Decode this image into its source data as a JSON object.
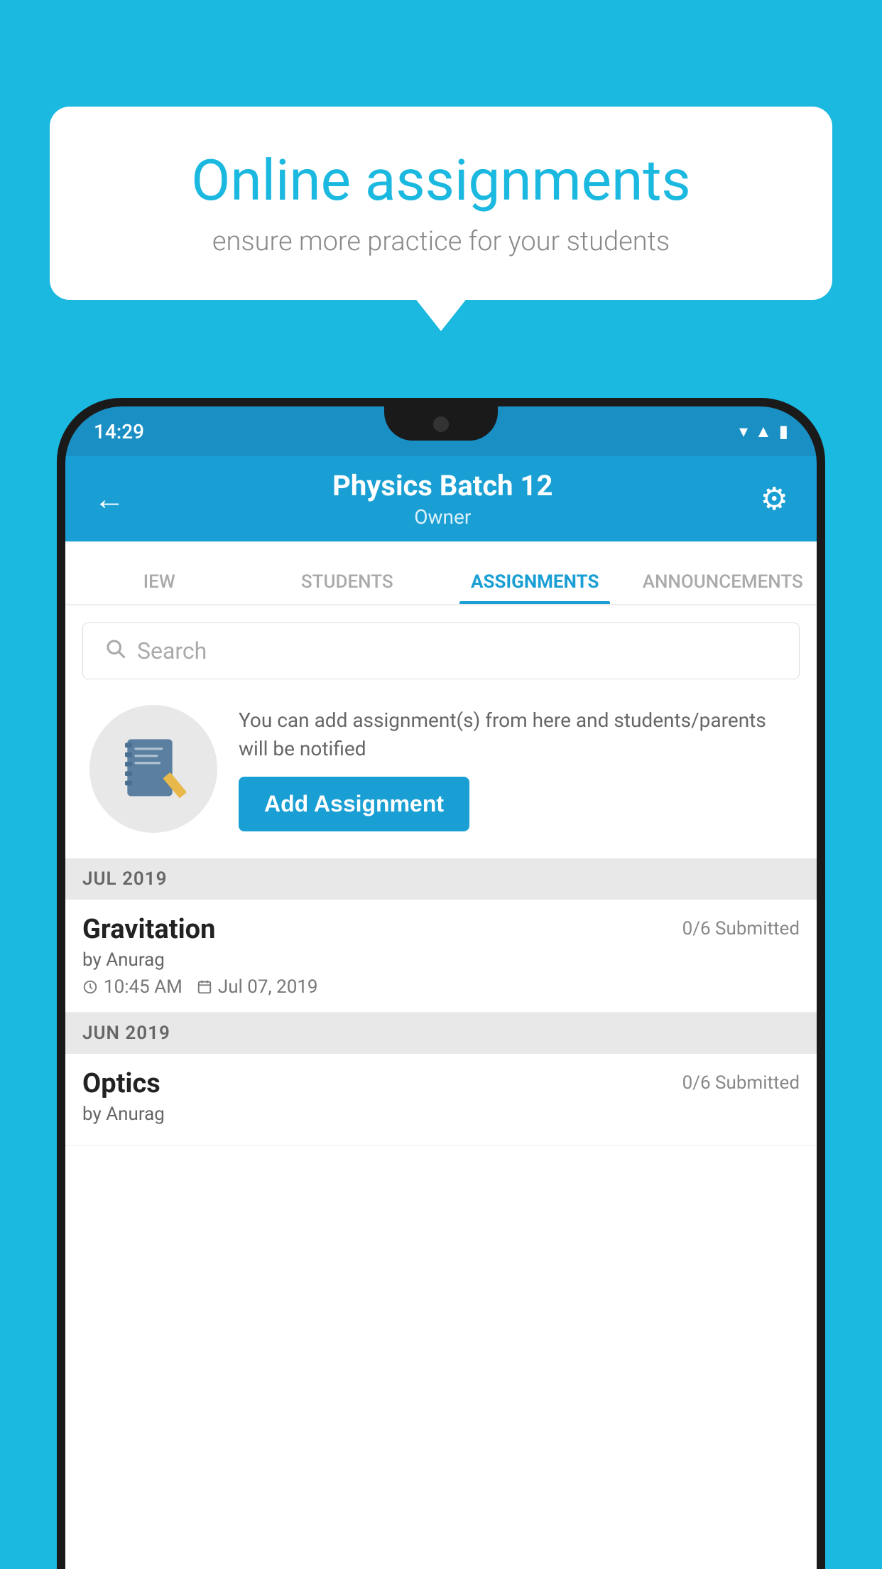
{
  "background_color": "#1BB8E0",
  "speech_bubble": {
    "title": "Online assignments",
    "subtitle": "ensure more practice for your students"
  },
  "status_bar": {
    "time": "14:29",
    "icons": [
      "wifi",
      "signal",
      "battery"
    ]
  },
  "header": {
    "title": "Physics Batch 12",
    "subtitle": "Owner",
    "back_label": "←",
    "settings_label": "⚙"
  },
  "tabs": [
    {
      "label": "IEW",
      "active": false
    },
    {
      "label": "STUDENTS",
      "active": false
    },
    {
      "label": "ASSIGNMENTS",
      "active": true
    },
    {
      "label": "ANNOUNCEMENTS",
      "active": false
    }
  ],
  "search": {
    "placeholder": "Search"
  },
  "empty_state": {
    "description": "You can add assignment(s) from here and students/parents will be notified",
    "button_label": "Add Assignment"
  },
  "sections": [
    {
      "month": "JUL 2019",
      "assignments": [
        {
          "name": "Gravitation",
          "submitted": "0/6 Submitted",
          "by": "by Anurag",
          "time": "10:45 AM",
          "date": "Jul 07, 2019"
        }
      ]
    },
    {
      "month": "JUN 2019",
      "assignments": [
        {
          "name": "Optics",
          "submitted": "0/6 Submitted",
          "by": "by Anurag",
          "time": "",
          "date": ""
        }
      ]
    }
  ]
}
